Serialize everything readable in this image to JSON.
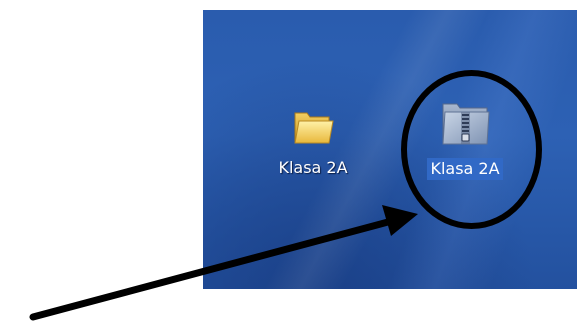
{
  "desktop": {
    "icons": [
      {
        "label": "Klasa 2A",
        "type": "folder",
        "icon": "folder-icon",
        "selected": false
      },
      {
        "label": "Klasa 2A",
        "type": "compressed-folder",
        "icon": "zip-folder-icon",
        "selected": true
      }
    ]
  },
  "annotation": {
    "circle_color": "#000000",
    "arrow_color": "#000000"
  },
  "colors": {
    "desktop_blue": "#2a5cae",
    "selection_blue": "#3169c6"
  }
}
